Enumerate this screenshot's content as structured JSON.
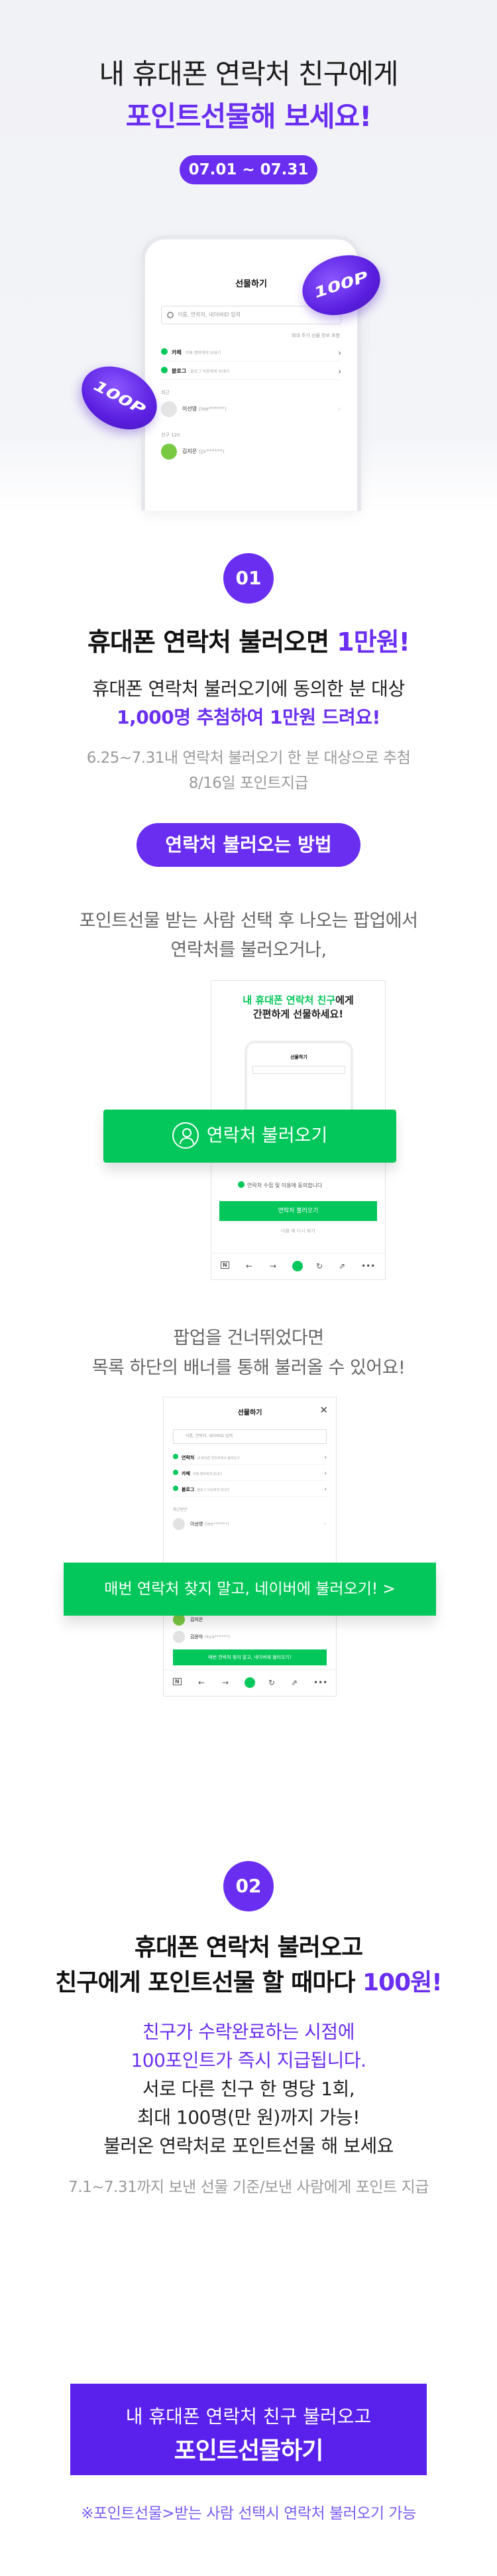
{
  "hero": {
    "title_line1": "내 휴대폰 연락처 친구에게",
    "title_line2": "포인트선물해 보세요!",
    "date_range": "07.01 ~ 07.31",
    "coin_label": "100P",
    "phone": {
      "title": "선물하기",
      "search_placeholder": "이름, 연락처, 네이버ID 입력",
      "note": "최대 주기 선물 정보 포함",
      "rows": [
        {
          "label": "카페",
          "sub": "카페 멤버에게 보내기"
        },
        {
          "label": "블로그",
          "sub": "블로그 이웃에게 보내기"
        }
      ],
      "section_recent": "최근",
      "section_friends": "친구 120",
      "people": [
        {
          "name": "이선영",
          "id": "(lee******)"
        },
        {
          "name": "김지은",
          "id": "(jjs******)"
        }
      ]
    }
  },
  "section1": {
    "number": "01",
    "title_pre": "휴대폰 연락처 불러오면 ",
    "title_hl": "1만원!",
    "line1": "휴대폰 연락처 불러오기에 동의한 분 대상",
    "line2": "1,000명 추첨하여 1만원 드려요!",
    "note1": "6.25~7.31내 연락처 불러오기 한 분 대상으로 추첨",
    "note2": "8/16일 포인트지급",
    "how_button": "연락처 불러오는 방법",
    "desc1_line1": "포인트선물 받는 사람 선택 후 나오는 팝업에서",
    "desc1_line2": "연락처를 불러오거나,",
    "mock_a": {
      "headline_green": "내 휴대폰 연락처 친구",
      "headline_rest": "에게",
      "headline_line2": "간편하게 선물하세요!",
      "check_text": "연락처 수집 및 이용에 동의합니다",
      "mini_button": "연락처 불러오기",
      "mini_note": "다음 에 다시 보기"
    },
    "green_button": "연락처 불러오기",
    "desc2_line1": "팝업을 건너뛰었다면",
    "desc2_line2": "목록 하단의 배너를 통해 불러올 수 있어요!",
    "mock_b": {
      "title": "선물하기",
      "search_placeholder": "이름, 연락처, 네이버ID 입력",
      "rows": [
        {
          "label": "연락처",
          "sub": "내 휴대폰 연락처에서 불러오기"
        },
        {
          "label": "카페",
          "sub": "카페 멤버에게 보내기"
        },
        {
          "label": "블로그",
          "sub": "블로그 이웃에게 보내기"
        }
      ],
      "section_recent": "최근받은",
      "people": [
        {
          "name": "이선영",
          "id": "(lee******)"
        },
        {
          "name": "김지은",
          "id": ""
        },
        {
          "name": "김윤아",
          "id": "(kya******)"
        }
      ],
      "bottom_bar": "매번 연락처 찾지 말고, 네이버에 불러오기!"
    },
    "banner_text": "매번 연락처 찾지 말고, 네이버에 불러오기! >"
  },
  "section2": {
    "number": "02",
    "title_line1": "휴대폰 연락처 불러오고",
    "title_line2_pre": "친구에게 포인트선물 할 때마다 ",
    "title_line2_hl": "100원!",
    "line1": "친구가 수락완료하는 시점에",
    "line2": "100포인트가 즉시 지급됩니다.",
    "line3": "서로 다른 친구 한 명당 1회,",
    "line4": "최대 100명(만 원)까지 가능!",
    "line5": "불러온 연락처로 포인트선물 해 보세요",
    "note": "7.1~7.31까지 보낸 선물 기준/보낸 사람에게 포인트 지급"
  },
  "cta": {
    "line1": "내 휴대폰 연락처 친구 불러오고",
    "line2": "포인트선물하기"
  },
  "footer_note": "※포인트선물>받는 사람 선택시 연락처 불러오기 가능",
  "colors": {
    "purple": "#6a2ef0",
    "green": "#03c75a",
    "cta": "#5a20ec"
  }
}
